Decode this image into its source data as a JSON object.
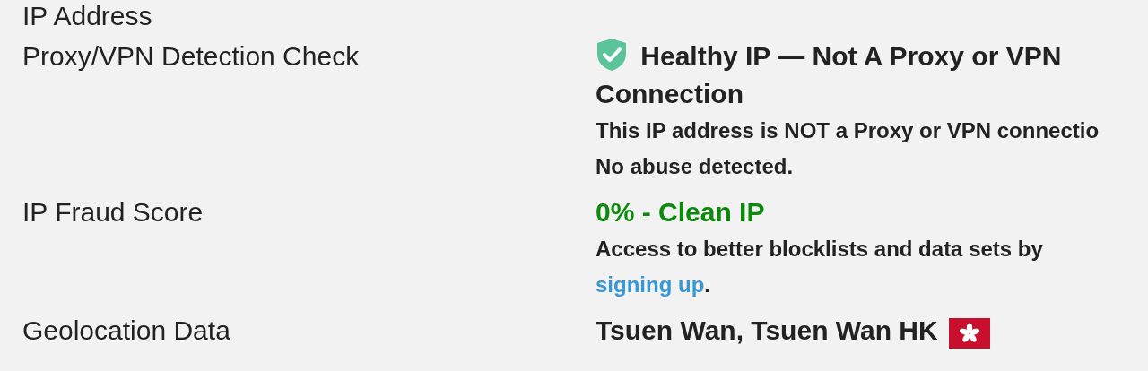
{
  "rows": [
    {
      "label": "IP Address"
    },
    {
      "label": "Proxy/VPN Detection Check",
      "status": {
        "kind": "healthy",
        "title": "Healthy IP — Not A Proxy or VPN Connection"
      },
      "notes": [
        "This IP address is NOT a Proxy or VPN connectio",
        "No abuse detected."
      ]
    },
    {
      "label": "IP Fraud Score",
      "score": "0% - Clean IP",
      "prompt": {
        "before": "Access to better blocklists and data sets by ",
        "link": "signing up",
        "after": "."
      }
    },
    {
      "label": "Geolocation Data",
      "location": "Tsuen Wan, Tsuen Wan HK"
    }
  ]
}
